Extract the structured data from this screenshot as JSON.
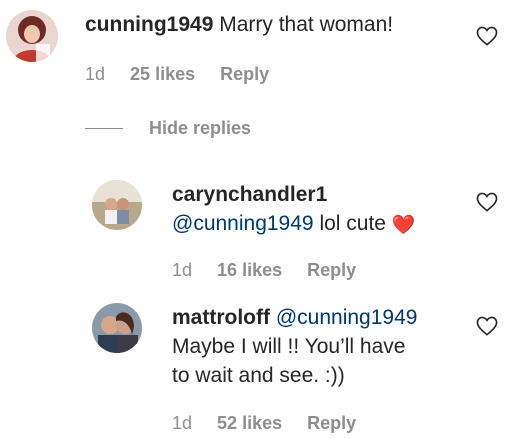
{
  "comments": [
    {
      "username": "cunning1949",
      "text": "Marry that woman!",
      "age": "1d",
      "likes": "25 likes",
      "reply": "Reply"
    }
  ],
  "hide_replies": "Hide replies",
  "replies": [
    {
      "username": "carynchandler1",
      "mention": "@cunning1949",
      "text": "lol cute",
      "emoji": "❤️",
      "age": "1d",
      "likes": "16 likes",
      "reply": "Reply"
    },
    {
      "username": "mattroloff",
      "mention": "@cunning1949",
      "text_line1": "Maybe I will !! You’ll have",
      "text_line2": "to wait and see. :))",
      "age": "1d",
      "likes": "52 likes",
      "reply": "Reply"
    }
  ],
  "colors": {
    "text": "#262626",
    "muted": "#8e8e8e",
    "mention": "#00376b",
    "heart_emoji": "#ed1c24"
  },
  "icons": {
    "like": "heart-outline-icon"
  }
}
